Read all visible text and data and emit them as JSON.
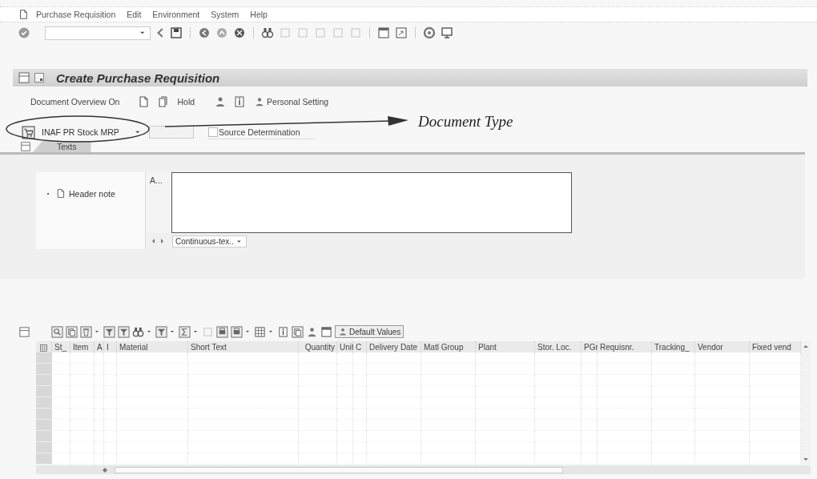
{
  "menu": [
    {
      "label": "Purchase Requisition"
    },
    {
      "label": "Edit"
    },
    {
      "label": "Environment"
    },
    {
      "label": "System"
    },
    {
      "label": "Help"
    }
  ],
  "title": "Create Purchase Requisition",
  "app_toolbar": {
    "overview_button": "Document Overview On",
    "hold_button": "Hold",
    "personal_setting_button": "Personal Setting"
  },
  "document_type": {
    "value": "INAF PR Stock MRP"
  },
  "source_determination": {
    "label": "Source Determination",
    "checked": false
  },
  "annotation": {
    "label": "Document Type"
  },
  "tabs": [
    {
      "label": "Texts",
      "selected": true
    }
  ],
  "texts": {
    "tree": [
      {
        "label": "Header note"
      }
    ],
    "column_header": "A...",
    "format_select": "Continuous-tex.."
  },
  "items_toolbar": {
    "default_values_button": "Default Values"
  },
  "table": {
    "columns": [
      "St_",
      "Item",
      "A",
      "I",
      "Material",
      "Short Text",
      "Quantity",
      "Unit",
      "C",
      "Delivery Date",
      "Matl Group",
      "Plant",
      "Stor. Loc.",
      "PGr",
      "Requisnr.",
      "Tracking_",
      "Vendor",
      "Fixed vend"
    ]
  }
}
